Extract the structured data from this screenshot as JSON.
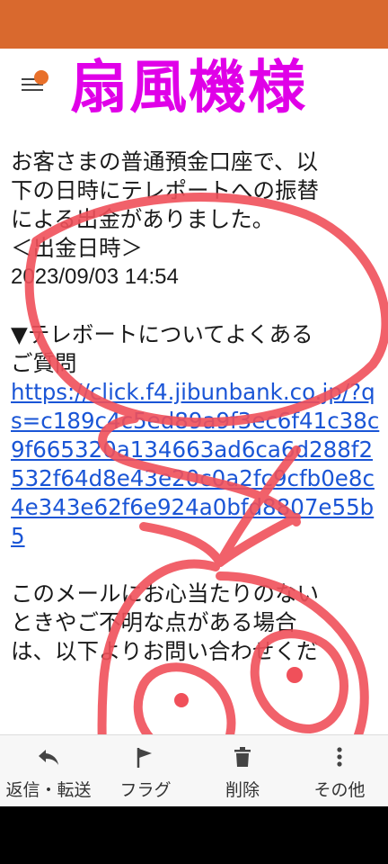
{
  "header": {
    "sender_name": "扇風機様",
    "menu_icon": "hamburger-menu-icon",
    "notification_color": "#e8702a"
  },
  "email": {
    "body_lines": [
      "お客さまの普通預金口座で、以",
      "下の日時にテレポートへの振替",
      "による出金がありました。",
      "＜出金日時＞"
    ],
    "date_time": "2023/09/03 14:54",
    "faq_lines": [
      "▼テレボートについてよくある",
      "ご質問"
    ],
    "link_text": "https://click.f4.jibunbank.co.jp/?qs=c189c4c5ed89a9f3ec6f41c38c9f665320a134663ad6ca6d288f2532f64d8e43e20c0a2fc9cfb0e8c4e343e62f6e924a0bfd8807e55b5",
    "footer_lines": [
      "このメールにお心当たりのない",
      "ときやご不明な点がある場合",
      "は、以下よりお問い合わせくだ"
    ]
  },
  "toolbar": {
    "reply_label": "返信・転送",
    "flag_label": "フラグ",
    "delete_label": "削除",
    "more_label": "その他"
  },
  "colors": {
    "status_bar": "#d9692e",
    "sender": "#e000e8",
    "link": "#1a55d6",
    "scribble": "#f0505a"
  }
}
